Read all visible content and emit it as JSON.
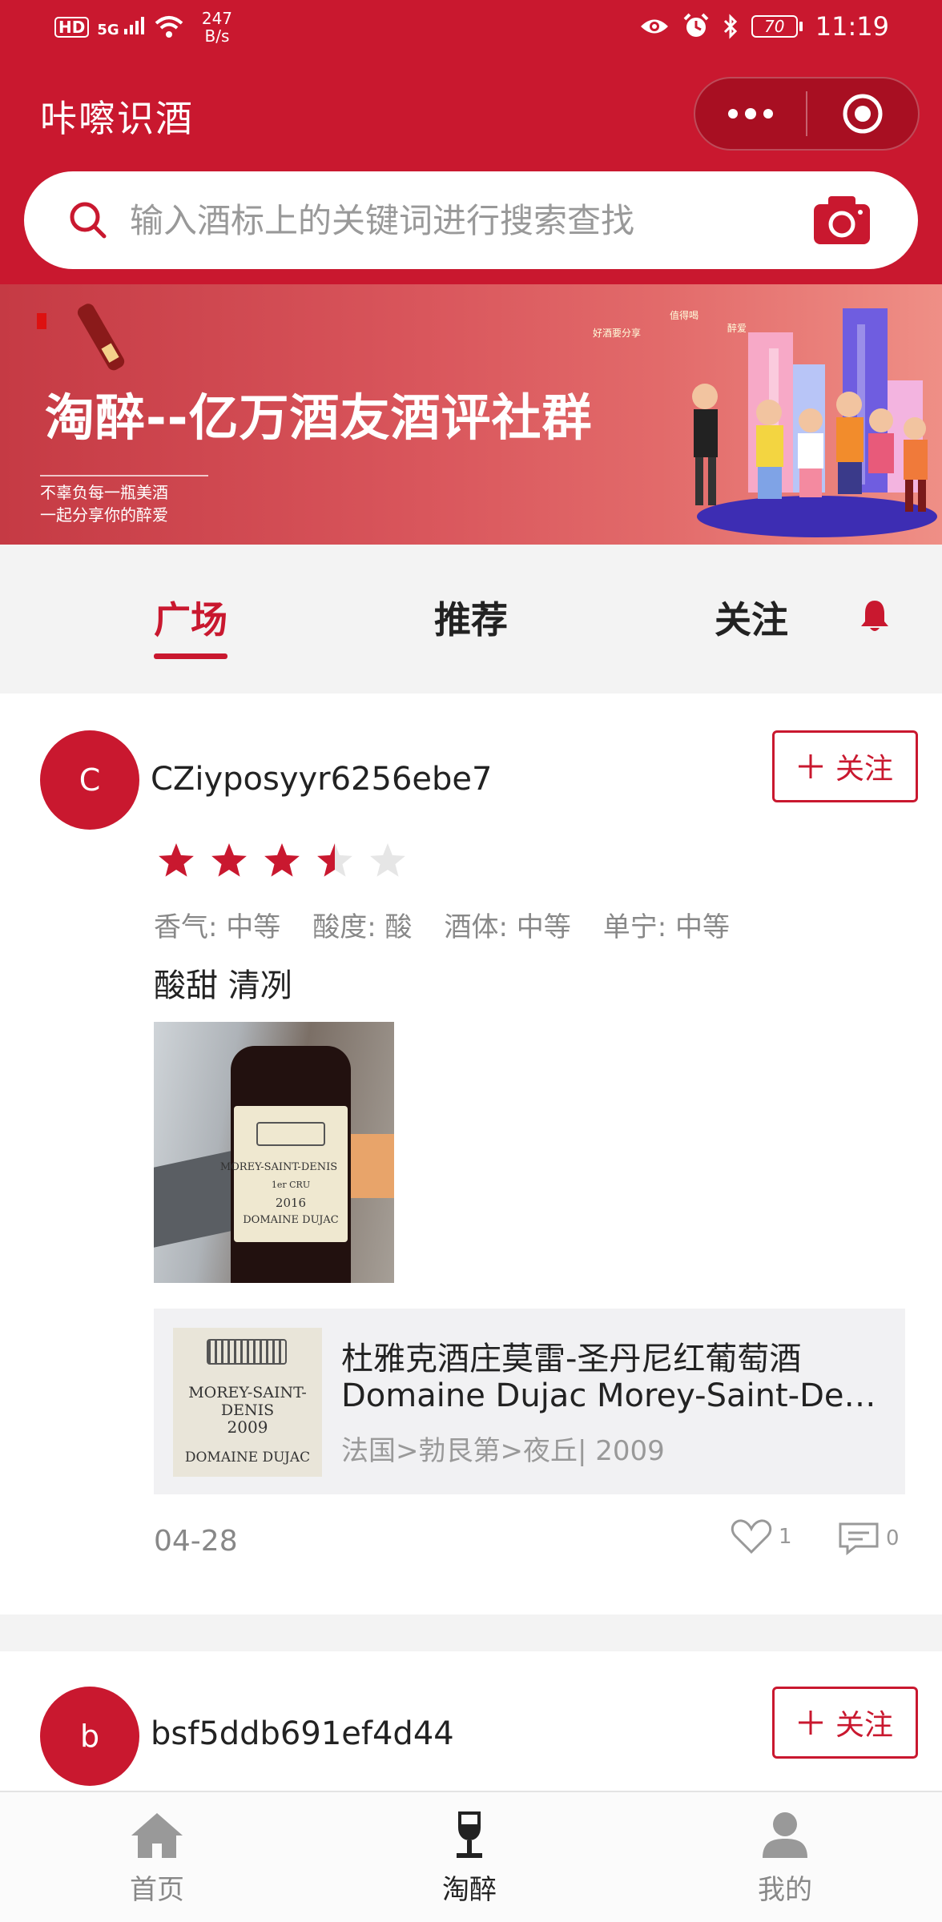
{
  "status_bar": {
    "left_hd": "HD",
    "left_signal": "5G",
    "net_speed_value": "247",
    "net_speed_unit": "B/s",
    "battery": "70",
    "time": "11:19"
  },
  "app": {
    "title": "咔嚓识酒"
  },
  "search": {
    "placeholder": "输入酒标上的关键词进行搜索查找"
  },
  "banner": {
    "title": "淘醉--亿万酒友酒评社群",
    "sub_line1": "不辜负每一瓶美酒",
    "sub_line2": "一起分享你的醉爱",
    "tag1": "好酒要分享",
    "tag2": "值得喝",
    "tag3": "醉爱"
  },
  "tabs": [
    {
      "label": "广场",
      "active": true
    },
    {
      "label": "推荐",
      "active": false
    },
    {
      "label": "关注",
      "active": false
    }
  ],
  "posts": [
    {
      "avatar_letter": "C",
      "username": "CZiyposyyr6256ebe7",
      "follow_label": "关注",
      "rating": 3.5,
      "rating_max": 5,
      "tags": [
        "香气: 中等",
        "酸度: 酸",
        "酒体: 中等",
        "单宁: 中等"
      ],
      "note": "酸甜 清冽",
      "photo_label": {
        "line1": "MOREY-SAINT-DENIS",
        "line2": "1er CRU",
        "line3": "2016",
        "line4": "DOMAINE DUJAC"
      },
      "wine": {
        "name_cn": "杜雅克酒庄莫雷-圣丹尼红葡萄酒",
        "name_en": "Domaine Dujac Morey-Saint-Denis",
        "origin": "法国>勃艮第>夜丘| 2009",
        "thumb_line1": "MOREY-SAINT-DENIS",
        "thumb_line2": "2009",
        "thumb_line3": "DOMAINE DUJAC"
      },
      "date": "04-28",
      "likes": "1",
      "comments": "0"
    },
    {
      "avatar_letter": "b",
      "username": "bsf5ddb691ef4d44",
      "follow_label": "关注"
    }
  ],
  "bottom_nav": [
    {
      "label": "首页",
      "icon": "home-icon",
      "active": false
    },
    {
      "label": "淘醉",
      "icon": "wine-glass-icon",
      "active": true
    },
    {
      "label": "我的",
      "icon": "user-icon",
      "active": false
    }
  ],
  "colors": {
    "brand_red": "#c9182f",
    "text_dark": "#222222",
    "text_gray": "#888888"
  }
}
